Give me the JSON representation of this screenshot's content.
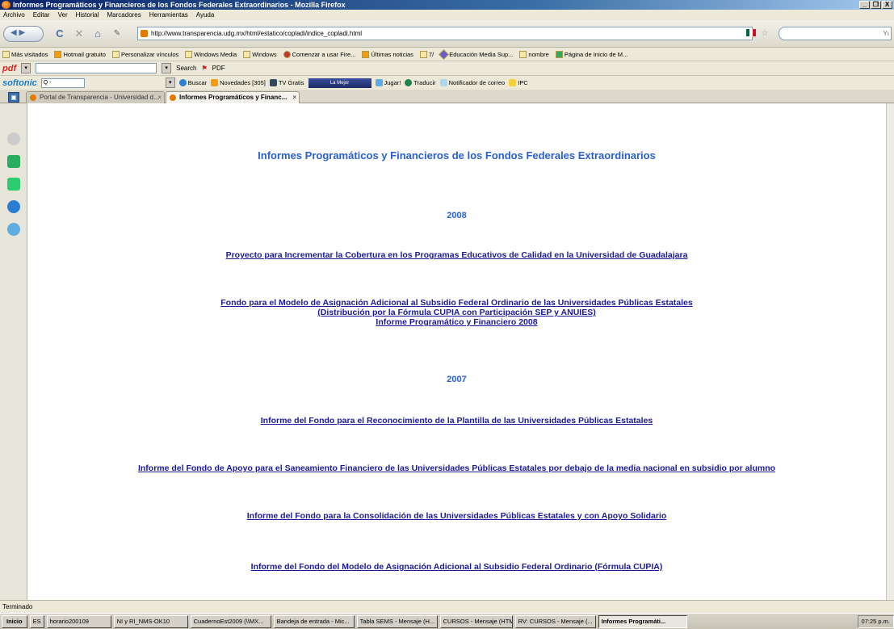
{
  "window": {
    "title": "Informes Programáticos y Financieros de los Fondos Federales Extraordinarios - Mozilla Firefox",
    "minimize": "_",
    "restore": "❐",
    "close": "X"
  },
  "menu": [
    "Archivo",
    "Editar",
    "Ver",
    "Historial",
    "Marcadores",
    "Herramientas",
    "Ayuda"
  ],
  "nav": {
    "url": "http://www.transparencia.udg.mx/html/estatico/copladi/indice_copladi.html",
    "search_placeholder": "Yı",
    "reload": "C",
    "stop": "✕",
    "home": "⌂",
    "back_label": "◀ ▶"
  },
  "bookmarks": [
    "Más visitados",
    "Hotmail gratuito",
    "Personalizar vínculos",
    "Windows Media",
    "Windows",
    "Comenzar a usar Fire...",
    "Últimas noticias",
    "7/",
    "Educación Media Sup...",
    "nombre",
    "Página de Inicio de M..."
  ],
  "pdfbar": {
    "logo": "pdf",
    "search_label": "Search",
    "pdf_label": "PDF"
  },
  "softonic": {
    "logo": "softonic",
    "search_prefix": "Q -",
    "items": [
      "Buscar",
      "Novedades [305]",
      "TV Gratis",
      "Jugar!",
      "Traducir",
      "Notificador de correo",
      "IPC"
    ],
    "radio_text": "La Mejor"
  },
  "tabs": [
    {
      "label": "Portal de Transparencia - Universidad d...",
      "close": "×"
    },
    {
      "label": "Informes Programáticos y Financ...",
      "close": "×"
    }
  ],
  "page": {
    "title": "Informes Programáticos y Financieros de los Fondos Federales Extraordinarios",
    "year1": "2008",
    "link1": "Proyecto para Incrementar la Cobertura en los Programas Educativos de Calidad en la Universidad de Guadalajara",
    "link2_line1": "Fondo para el Modelo de Asignación Adicional al Subsidio Federal Ordinario de las Universidades Públicas Estatales",
    "link2_line2": "(Distribución por la Fórmula CUPIA con Participación SEP y ANUIES)",
    "link2_line3": "Informe Programático y Financiero 2008",
    "year2": "2007",
    "link3": "Informe del Fondo para el Reconocimiento de la Plantilla de las Universidades Públicas Estatales",
    "link4": "Informe del Fondo de Apoyo para el Saneamiento Financiero de las Universidades Públicas Estatales por debajo de la media nacional en subsidio por alumno",
    "link5": "Informe del Fondo para la Consolidación de las Universidades Públicas Estatales y con Apoyo Solidario",
    "link6": "Informe del Fondo del Modelo de Asignación Adicional al Subsidio Federal Ordinario (Fórmula CUPIA)"
  },
  "status": "Terminado",
  "taskbar": {
    "start": "Inicio",
    "lang": "ES",
    "items": [
      "horario200109",
      "NI y RI_NMS-OK10",
      "CuadernoEst2009 (\\\\MX...",
      "Bandeja de entrada - Mic...",
      "Tabla SEMS - Mensaje (H...",
      "CURSOS - Mensaje (HTML)",
      "RV: CURSOS - Mensaje (...",
      "Informes Programáti..."
    ],
    "clock": "07:25 p.m."
  }
}
